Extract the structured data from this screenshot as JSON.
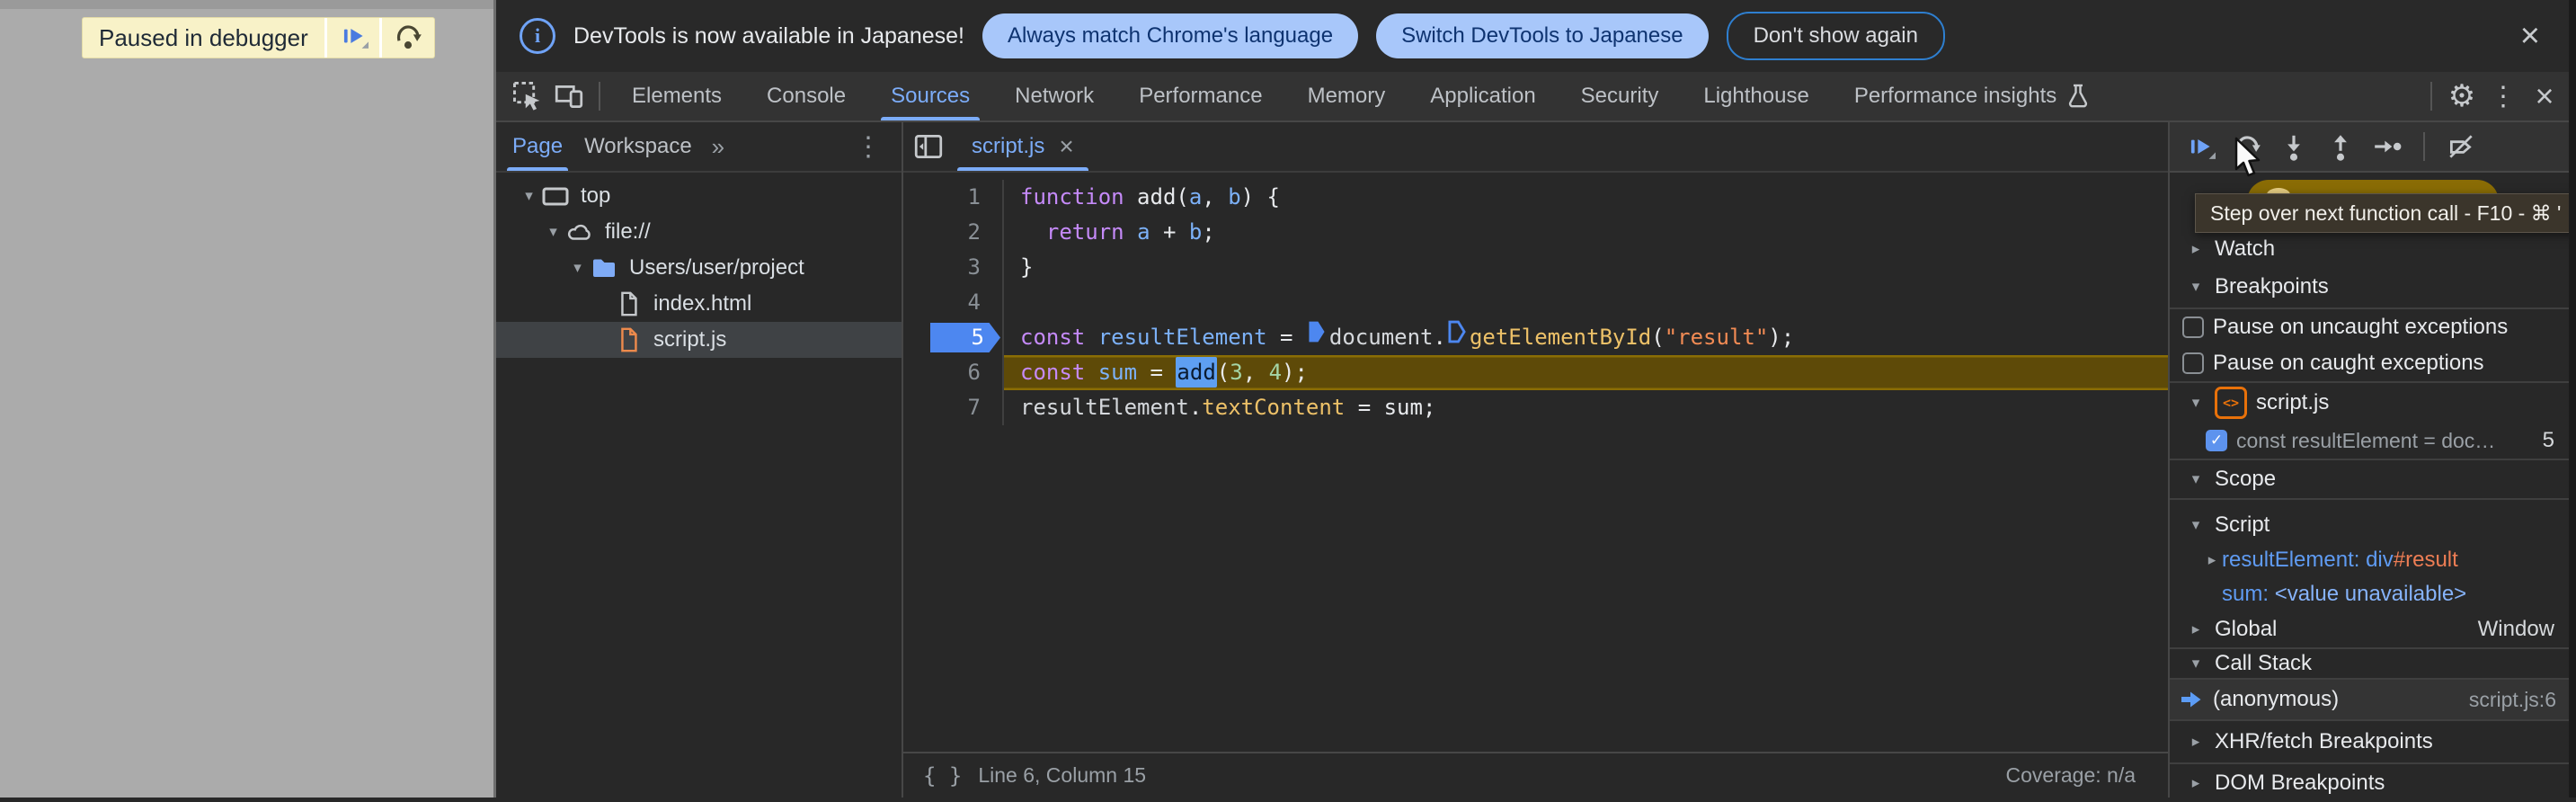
{
  "colors": {
    "accent_blue": "#7CACF8",
    "paused_banner_bg": "#F8F2C8",
    "execution_line_bg": "#5E4A08",
    "breakpoint_blue": "#4D87F0",
    "action_pill_bg": "#A8C7FA",
    "paused_pill_bg": "#8A6C05"
  },
  "icons": {
    "gear": "⚙",
    "overflow_menu": "⋮",
    "close": "×",
    "more_tabs": "»",
    "braces": "{ }",
    "check": "✓",
    "expanded": "▾",
    "collapsed": "▸",
    "info": "i",
    "bp_file_badge": "<>"
  },
  "page": {
    "paused_message": "Paused in debugger"
  },
  "notification": {
    "message": "DevTools is now available in Japanese!",
    "action_primary": "Always match Chrome's language",
    "action_secondary": "Switch DevTools to Japanese",
    "action_dismiss": "Don't show again"
  },
  "toolbar": {
    "tabs": [
      "Elements",
      "Console",
      "Sources",
      "Network",
      "Performance",
      "Memory",
      "Application",
      "Security",
      "Lighthouse",
      "Performance insights"
    ],
    "selected": "Sources"
  },
  "navigator": {
    "tabs": [
      {
        "label": "Page",
        "selected": true
      },
      {
        "label": "Workspace",
        "selected": false
      }
    ],
    "tree": [
      {
        "label": "top",
        "depth": 0,
        "icon": "frame",
        "expanded": true,
        "selected": false
      },
      {
        "label": "file://",
        "depth": 1,
        "icon": "cloud",
        "expanded": true,
        "selected": false
      },
      {
        "label": "Users/user/project",
        "depth": 2,
        "icon": "folder",
        "expanded": true,
        "selected": false
      },
      {
        "label": "index.html",
        "depth": 3,
        "icon": "file_html",
        "expanded": null,
        "selected": false
      },
      {
        "label": "script.js",
        "depth": 3,
        "icon": "file_js",
        "expanded": null,
        "selected": true
      }
    ]
  },
  "editor": {
    "tab": "script.js",
    "status_position": "Line 6, Column 15",
    "status_coverage": "Coverage: n/a",
    "breakpoint_line": 5,
    "execution_line": 6,
    "lines": [
      {
        "n": 1,
        "tokens": [
          {
            "c": "kw",
            "v": "function"
          },
          {
            "c": "plain",
            "v": " add("
          },
          {
            "c": "var",
            "v": "a"
          },
          {
            "c": "plain",
            "v": ", "
          },
          {
            "c": "var",
            "v": "b"
          },
          {
            "c": "plain",
            "v": ") {"
          }
        ]
      },
      {
        "n": 2,
        "tokens": [
          {
            "c": "plain",
            "v": "  "
          },
          {
            "c": "kw",
            "v": "return"
          },
          {
            "c": "plain",
            "v": " "
          },
          {
            "c": "var",
            "v": "a"
          },
          {
            "c": "plain",
            "v": " + "
          },
          {
            "c": "var",
            "v": "b"
          },
          {
            "c": "plain",
            "v": ";"
          }
        ]
      },
      {
        "n": 3,
        "tokens": [
          {
            "c": "plain",
            "v": "}"
          }
        ]
      },
      {
        "n": 4,
        "tokens": []
      },
      {
        "n": 5,
        "tokens": [
          {
            "c": "kw",
            "v": "const"
          },
          {
            "c": "plain",
            "v": " "
          },
          {
            "c": "var",
            "v": "resultElement"
          },
          {
            "c": "plain",
            "v": " = "
          },
          {
            "c": "mk_filled"
          },
          {
            "c": "obj",
            "v": "document"
          },
          {
            "c": "plain",
            "v": "."
          },
          {
            "c": "mk_hollow"
          },
          {
            "c": "fn",
            "v": "getElementById"
          },
          {
            "c": "plain",
            "v": "("
          },
          {
            "c": "str",
            "v": "\"result\""
          },
          {
            "c": "plain",
            "v": ");"
          }
        ]
      },
      {
        "n": 6,
        "tokens": [
          {
            "c": "kw",
            "v": "const"
          },
          {
            "c": "plain",
            "v": " "
          },
          {
            "c": "var",
            "v": "sum"
          },
          {
            "c": "plain",
            "v": " = "
          },
          {
            "c": "sel",
            "v": "add"
          },
          {
            "c": "plain",
            "v": "("
          },
          {
            "c": "num",
            "v": "3"
          },
          {
            "c": "plain",
            "v": ", "
          },
          {
            "c": "num",
            "v": "4"
          },
          {
            "c": "plain",
            "v": ");"
          }
        ]
      },
      {
        "n": 7,
        "tokens": [
          {
            "c": "obj",
            "v": "resultElement"
          },
          {
            "c": "plain",
            "v": "."
          },
          {
            "c": "fn",
            "v": "textContent"
          },
          {
            "c": "plain",
            "v": " = sum;"
          }
        ]
      }
    ]
  },
  "debugger": {
    "tooltip": "Step over next function call - F10 - ⌘ '",
    "watch_title": "Watch",
    "breakpoints": {
      "title": "Breakpoints",
      "options": [
        {
          "label": "Pause on uncaught exceptions",
          "checked": false
        },
        {
          "label": "Pause on caught exceptions",
          "checked": false
        }
      ],
      "file": "script.js",
      "entries": [
        {
          "snippet": "const resultElement = doc…",
          "line": "5",
          "checked": true
        }
      ]
    },
    "scope": {
      "title": "Scope",
      "script_group": "Script",
      "variables": [
        {
          "name": "resultElement",
          "expandable": true,
          "parts": [
            {
              "c": "vtag",
              "v": "div"
            },
            {
              "c": "vid",
              "v": "#result"
            }
          ]
        },
        {
          "name": "sum",
          "expandable": false,
          "parts": [
            {
              "c": "vblue",
              "v": "<value unavailable>"
            }
          ]
        }
      ],
      "global_group": "Global",
      "global_value": "Window"
    },
    "call_stack": {
      "title": "Call Stack",
      "frames": [
        {
          "name": "(anonymous)",
          "location": "script.js:6",
          "active": true
        }
      ]
    },
    "xhr_title": "XHR/fetch Breakpoints",
    "dom_title": "DOM Breakpoints"
  }
}
